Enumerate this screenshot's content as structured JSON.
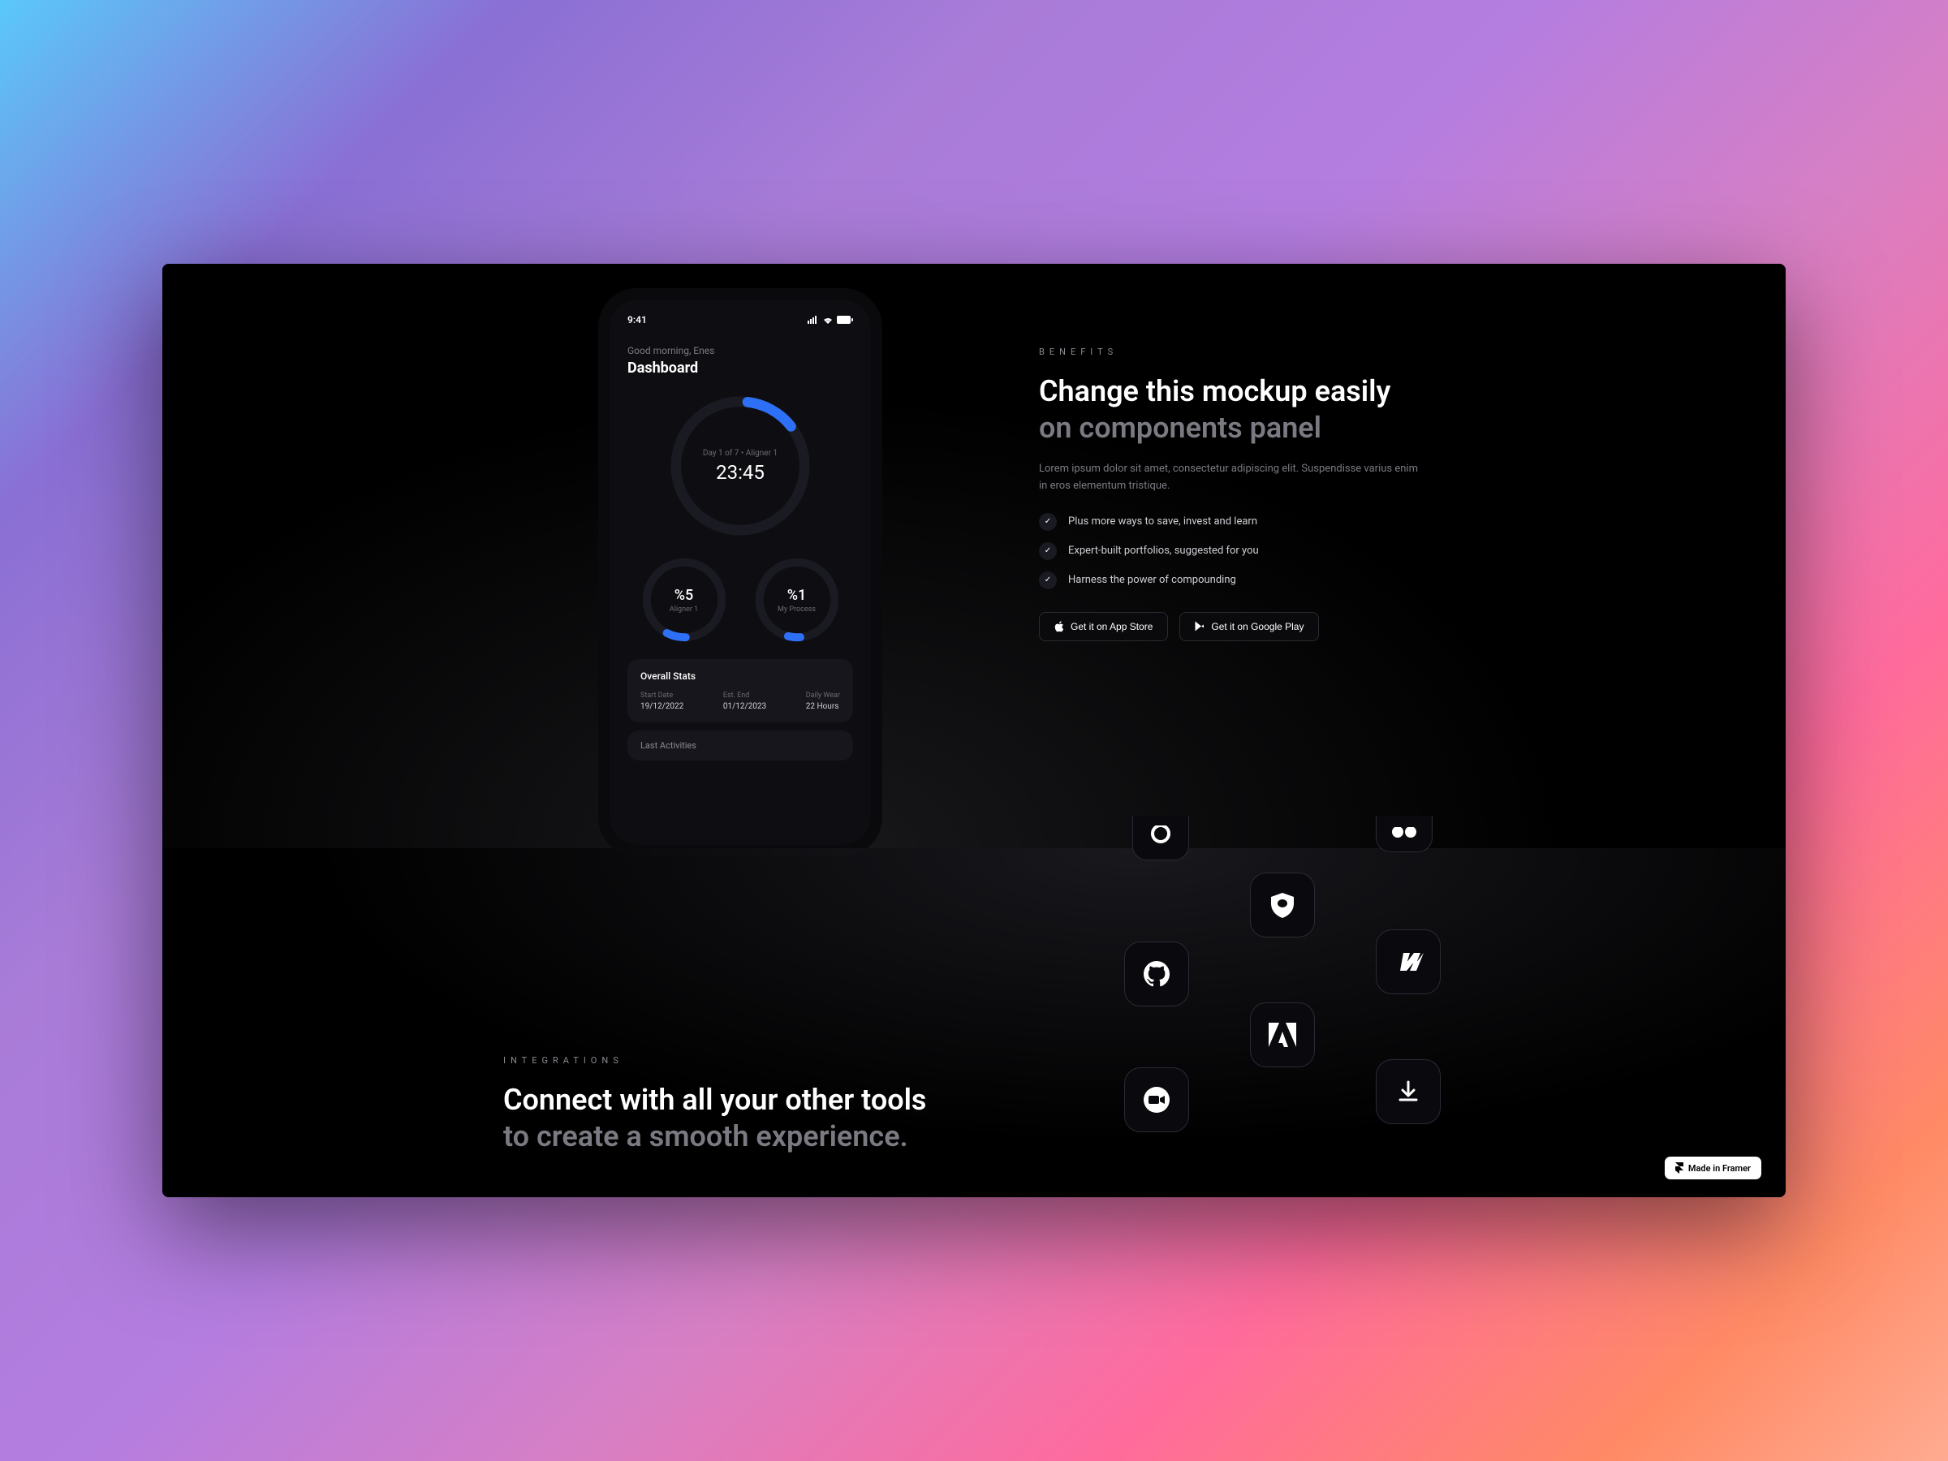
{
  "phone": {
    "time": "9:41",
    "greeting": "Good morning, Enes",
    "title": "Dashboard",
    "main_dial": {
      "sub": "Day 1 of 7 • Aligner 1",
      "time": "23:45"
    },
    "dial_left": {
      "value": "%5",
      "label": "Aligner 1"
    },
    "dial_right": {
      "value": "%1",
      "label": "My Process"
    },
    "stats": {
      "title": "Overall Stats",
      "items": [
        {
          "label": "Start Date",
          "value": "19/12/2022"
        },
        {
          "label": "Est. End",
          "value": "01/12/2023"
        },
        {
          "label": "Daily Wear",
          "value": "22 Hours"
        }
      ]
    },
    "last_activities": "Last Activities"
  },
  "benefits": {
    "eyebrow": "BENEFITS",
    "title_line1": "Change this mockup easily",
    "title_line2": "on components panel",
    "body": "Lorem ipsum dolor sit amet, consectetur adipiscing elit. Suspendisse varius enim in eros elementum tristique.",
    "features": [
      "Plus more ways to save, invest and learn",
      "Expert-built portfolios, suggested for you",
      "Harness the power of compounding"
    ],
    "btn_apple": "Get it on App Store",
    "btn_google": "Get it on Google Play"
  },
  "integrations": {
    "eyebrow": "INTEGRATIONS",
    "title_line1": "Connect with all your other tools",
    "title_line2": "to create a smooth experience."
  },
  "badge": "Made in Framer"
}
